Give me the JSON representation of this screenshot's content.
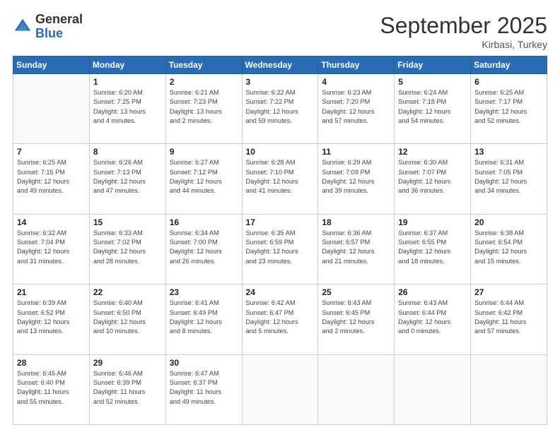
{
  "logo": {
    "general": "General",
    "blue": "Blue"
  },
  "title": "September 2025",
  "subtitle": "Kirbasi, Turkey",
  "headers": [
    "Sunday",
    "Monday",
    "Tuesday",
    "Wednesday",
    "Thursday",
    "Friday",
    "Saturday"
  ],
  "weeks": [
    [
      {
        "day": "",
        "info": ""
      },
      {
        "day": "1",
        "info": "Sunrise: 6:20 AM\nSunset: 7:25 PM\nDaylight: 13 hours\nand 4 minutes."
      },
      {
        "day": "2",
        "info": "Sunrise: 6:21 AM\nSunset: 7:23 PM\nDaylight: 13 hours\nand 2 minutes."
      },
      {
        "day": "3",
        "info": "Sunrise: 6:22 AM\nSunset: 7:22 PM\nDaylight: 12 hours\nand 59 minutes."
      },
      {
        "day": "4",
        "info": "Sunrise: 6:23 AM\nSunset: 7:20 PM\nDaylight: 12 hours\nand 57 minutes."
      },
      {
        "day": "5",
        "info": "Sunrise: 6:24 AM\nSunset: 7:18 PM\nDaylight: 12 hours\nand 54 minutes."
      },
      {
        "day": "6",
        "info": "Sunrise: 6:25 AM\nSunset: 7:17 PM\nDaylight: 12 hours\nand 52 minutes."
      }
    ],
    [
      {
        "day": "7",
        "info": "Sunrise: 6:25 AM\nSunset: 7:15 PM\nDaylight: 12 hours\nand 49 minutes."
      },
      {
        "day": "8",
        "info": "Sunrise: 6:26 AM\nSunset: 7:13 PM\nDaylight: 12 hours\nand 47 minutes."
      },
      {
        "day": "9",
        "info": "Sunrise: 6:27 AM\nSunset: 7:12 PM\nDaylight: 12 hours\nand 44 minutes."
      },
      {
        "day": "10",
        "info": "Sunrise: 6:28 AM\nSunset: 7:10 PM\nDaylight: 12 hours\nand 41 minutes."
      },
      {
        "day": "11",
        "info": "Sunrise: 6:29 AM\nSunset: 7:09 PM\nDaylight: 12 hours\nand 39 minutes."
      },
      {
        "day": "12",
        "info": "Sunrise: 6:30 AM\nSunset: 7:07 PM\nDaylight: 12 hours\nand 36 minutes."
      },
      {
        "day": "13",
        "info": "Sunrise: 6:31 AM\nSunset: 7:05 PM\nDaylight: 12 hours\nand 34 minutes."
      }
    ],
    [
      {
        "day": "14",
        "info": "Sunrise: 6:32 AM\nSunset: 7:04 PM\nDaylight: 12 hours\nand 31 minutes."
      },
      {
        "day": "15",
        "info": "Sunrise: 6:33 AM\nSunset: 7:02 PM\nDaylight: 12 hours\nand 28 minutes."
      },
      {
        "day": "16",
        "info": "Sunrise: 6:34 AM\nSunset: 7:00 PM\nDaylight: 12 hours\nand 26 minutes."
      },
      {
        "day": "17",
        "info": "Sunrise: 6:35 AM\nSunset: 6:59 PM\nDaylight: 12 hours\nand 23 minutes."
      },
      {
        "day": "18",
        "info": "Sunrise: 6:36 AM\nSunset: 6:57 PM\nDaylight: 12 hours\nand 21 minutes."
      },
      {
        "day": "19",
        "info": "Sunrise: 6:37 AM\nSunset: 6:55 PM\nDaylight: 12 hours\nand 18 minutes."
      },
      {
        "day": "20",
        "info": "Sunrise: 6:38 AM\nSunset: 6:54 PM\nDaylight: 12 hours\nand 15 minutes."
      }
    ],
    [
      {
        "day": "21",
        "info": "Sunrise: 6:39 AM\nSunset: 6:52 PM\nDaylight: 12 hours\nand 13 minutes."
      },
      {
        "day": "22",
        "info": "Sunrise: 6:40 AM\nSunset: 6:50 PM\nDaylight: 12 hours\nand 10 minutes."
      },
      {
        "day": "23",
        "info": "Sunrise: 6:41 AM\nSunset: 6:49 PM\nDaylight: 12 hours\nand 8 minutes."
      },
      {
        "day": "24",
        "info": "Sunrise: 6:42 AM\nSunset: 6:47 PM\nDaylight: 12 hours\nand 5 minutes."
      },
      {
        "day": "25",
        "info": "Sunrise: 6:43 AM\nSunset: 6:45 PM\nDaylight: 12 hours\nand 2 minutes."
      },
      {
        "day": "26",
        "info": "Sunrise: 6:43 AM\nSunset: 6:44 PM\nDaylight: 12 hours\nand 0 minutes."
      },
      {
        "day": "27",
        "info": "Sunrise: 6:44 AM\nSunset: 6:42 PM\nDaylight: 11 hours\nand 57 minutes."
      }
    ],
    [
      {
        "day": "28",
        "info": "Sunrise: 6:45 AM\nSunset: 6:40 PM\nDaylight: 11 hours\nand 55 minutes."
      },
      {
        "day": "29",
        "info": "Sunrise: 6:46 AM\nSunset: 6:39 PM\nDaylight: 11 hours\nand 52 minutes."
      },
      {
        "day": "30",
        "info": "Sunrise: 6:47 AM\nSunset: 6:37 PM\nDaylight: 11 hours\nand 49 minutes."
      },
      {
        "day": "",
        "info": ""
      },
      {
        "day": "",
        "info": ""
      },
      {
        "day": "",
        "info": ""
      },
      {
        "day": "",
        "info": ""
      }
    ]
  ]
}
